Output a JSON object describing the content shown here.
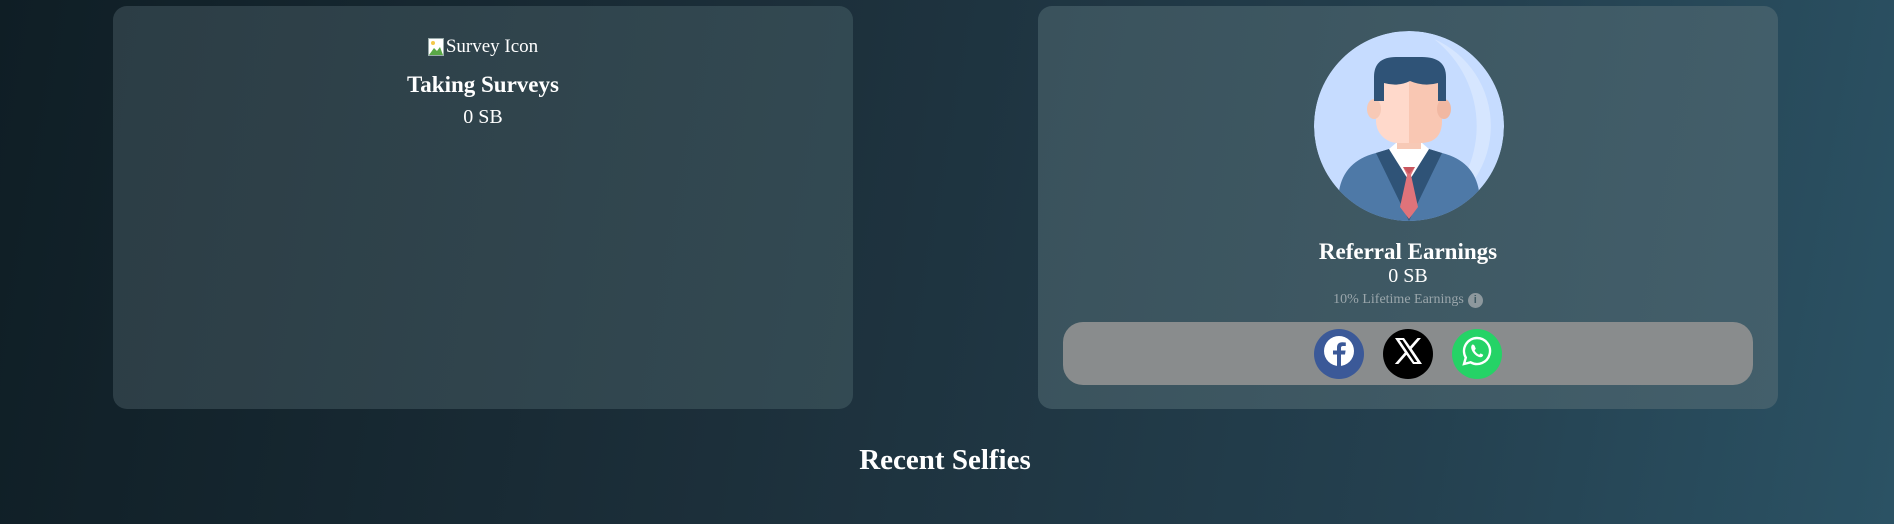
{
  "survey_card": {
    "icon_alt": "Survey Icon",
    "title": "Taking Surveys",
    "value": "0 SB"
  },
  "referral_card": {
    "title": "Referral Earnings",
    "value": "0 SB",
    "lifetime_note": "10% Lifetime Earnings",
    "info_glyph": "i",
    "share": [
      {
        "name": "facebook-icon",
        "color": "#3b5998"
      },
      {
        "name": "x-icon",
        "color": "#000000"
      },
      {
        "name": "whatsapp-icon",
        "color": "#25d366"
      }
    ]
  },
  "recent": {
    "title": "Recent Selfies"
  }
}
